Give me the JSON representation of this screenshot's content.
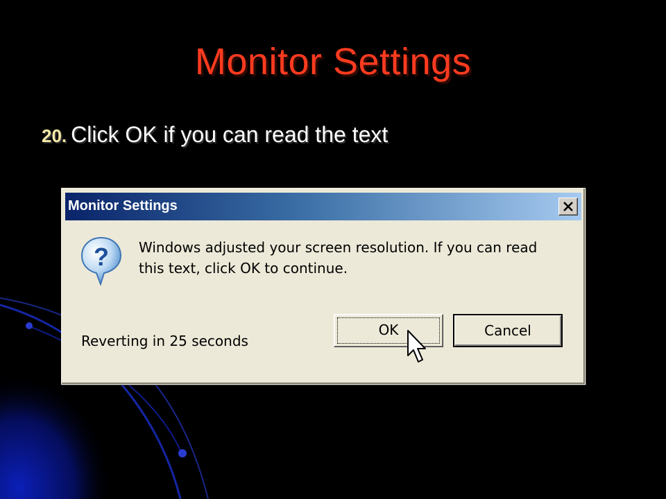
{
  "slide": {
    "title": "Monitor Settings",
    "step_number": "20.",
    "step_text": "Click OK if you can read the text"
  },
  "dialog": {
    "title": "Monitor Settings",
    "message_line1": "Windows adjusted your screen resolution. If you can read",
    "message_line2": "this text, click OK to continue.",
    "status_text": "Reverting in 25 seconds",
    "ok_label": "OK",
    "cancel_label": "Cancel",
    "icon": "question-icon",
    "close_icon": "close-icon"
  },
  "colors": {
    "background": "#000000",
    "title_color": "#ff3b1f",
    "step_number_color": "#f6e9a8",
    "titlebar_start": "#0a246a",
    "titlebar_end": "#a6caf0",
    "dialog_face": "#ece9d8"
  }
}
